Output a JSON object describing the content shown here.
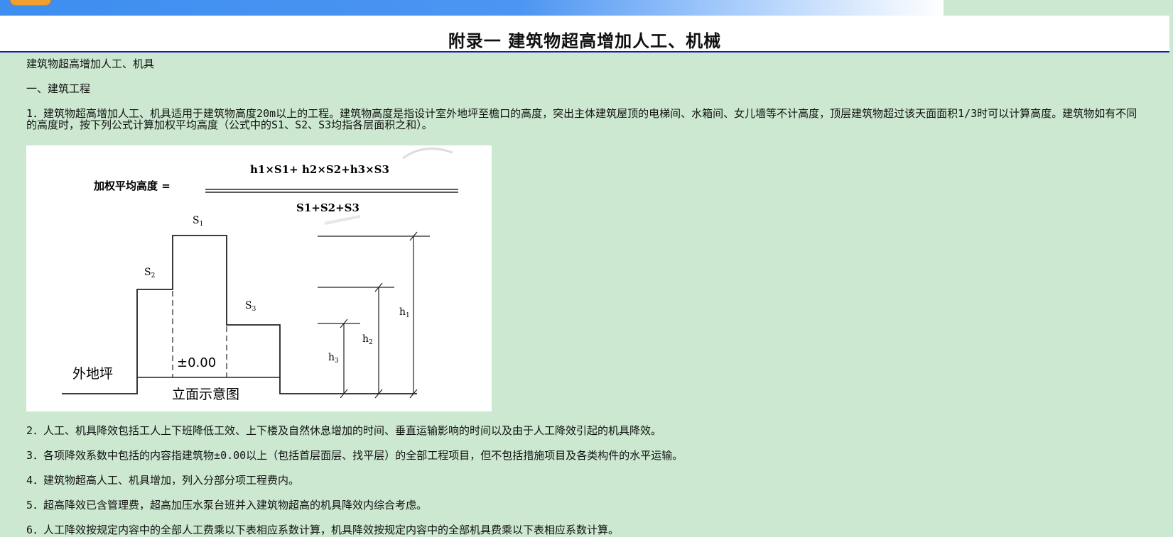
{
  "header": {
    "title": "附录一  建筑物超高增加人工、机械"
  },
  "content": {
    "subtitle": "建筑物超高增加人工、机具",
    "section": "一、建筑工程",
    "item1": "1．建筑物超高增加人工、机具适用于建筑物高度20m以上的工程。建筑物高度是指设计室外地坪至檐口的高度，突出主体建筑屋顶的电梯间、水箱间、女儿墙等不计高度，顶层建筑物超过该天面面积1/3时可以计算高度。建筑物如有不同的高度时，按下列公式计算加权平均高度（公式中的S1、S2、S3均指各层面积之和）。",
    "item2": "2．人工、机具降效包括工人上下班降低工效、上下楼及自然休息增加的时间、垂直运输影响的时间以及由于人工降效引起的机具降效。",
    "item3": "3．各项降效系数中包括的内容指建筑物±0.00以上（包括首层面层、找平层）的全部工程项目，但不包括措施项目及各类构件的水平运输。",
    "item4": "4．建筑物超高人工、机具增加，列入分部分项工程费内。",
    "item5": "5．超高降效已含管理费，超高加压水泵台班并入建筑物超高的机具降效内综合考虑。",
    "item6": "6．人工降效按规定内容中的全部人工费乘以下表相应系数计算，机具降效按规定内容中的全部机具费乘以下表相应系数计算。"
  },
  "diagram": {
    "formula_label": "加权平均高度 =",
    "numerator": "h1×S1+ h2×S2+h3×S3",
    "denominator": "S1+S2+S3",
    "s1": "S",
    "s1_sub": "1",
    "s2": "S",
    "s2_sub": "2",
    "s3": "S",
    "s3_sub": "3",
    "h1": "h",
    "h1_sub": "1",
    "h2": "h",
    "h2_sub": "2",
    "h3": "h",
    "h3_sub": "3",
    "zero_level": "±0.00",
    "ground_label": "外地坪",
    "caption": "立面示意图"
  }
}
